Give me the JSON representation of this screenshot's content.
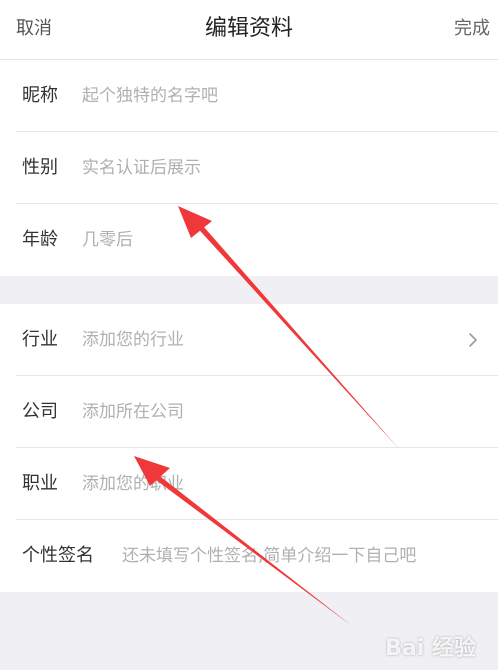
{
  "nav": {
    "cancel_label": "取消",
    "title": "编辑资料",
    "done_label": "完成"
  },
  "profile": {
    "nickname": {
      "label": "昵称",
      "placeholder": "起个独特的名字吧"
    },
    "gender": {
      "label": "性别",
      "placeholder": "实名认证后展示"
    },
    "age": {
      "label": "年龄",
      "placeholder": "几零后"
    }
  },
  "work": {
    "industry": {
      "label": "行业",
      "placeholder": "添加您的行业"
    },
    "company": {
      "label": "公司",
      "placeholder": "添加所在公司"
    },
    "occupation": {
      "label": "职业",
      "placeholder": "添加您的职业"
    },
    "signature": {
      "label": "个性签名",
      "placeholder": "还未填写个性签名,简单介绍一下自己吧"
    }
  },
  "watermark": {
    "text": "Bai 经验"
  },
  "colors": {
    "annotation_arrow": "#f0383a",
    "background": "#efeff4",
    "placeholder": "#b0b0b0"
  }
}
